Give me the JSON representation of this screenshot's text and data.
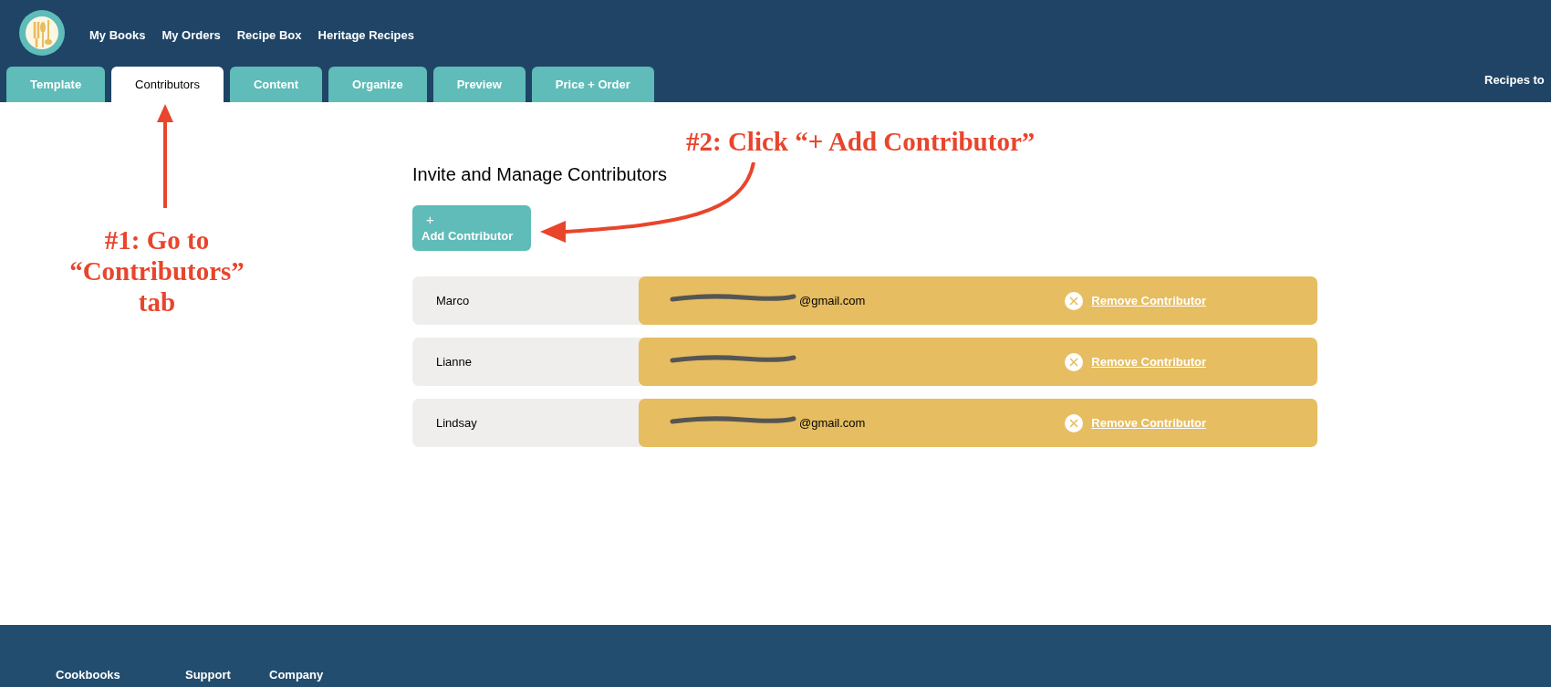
{
  "nav": {
    "links": [
      "My Books",
      "My Orders",
      "Recipe Box",
      "Heritage Recipes"
    ],
    "right_text": "Recipes to"
  },
  "tabs": [
    {
      "label": "Template",
      "selected": false
    },
    {
      "label": "Contributors",
      "selected": true
    },
    {
      "label": "Content",
      "selected": false
    },
    {
      "label": "Organize",
      "selected": false
    },
    {
      "label": "Preview",
      "selected": false
    },
    {
      "label": "Price + Order",
      "selected": false
    }
  ],
  "heading": "Invite and Manage Contributors",
  "add_button": {
    "icon_text": "+",
    "label": "Add Contributor"
  },
  "contributors": [
    {
      "name": "Marco",
      "email_visible": "@gmail.com",
      "redacted": true,
      "remove_label": "Remove Contributor"
    },
    {
      "name": "Lianne",
      "redacted": true,
      "remove_label": "Remove Contributor"
    },
    {
      "name": "Lindsay",
      "email_visible": "@gmail.com",
      "redacted": true,
      "remove_label": "Remove Contributor"
    }
  ],
  "footer": {
    "columns": [
      "Cookbooks",
      "Support",
      "Company"
    ]
  },
  "annotations": [
    {
      "kind": "step",
      "lines": [
        "#1: Go to",
        "“Contributors”",
        "tab"
      ]
    },
    {
      "kind": "step",
      "lines": [
        "#2: Click “+ Add Contributor”"
      ]
    }
  ]
}
